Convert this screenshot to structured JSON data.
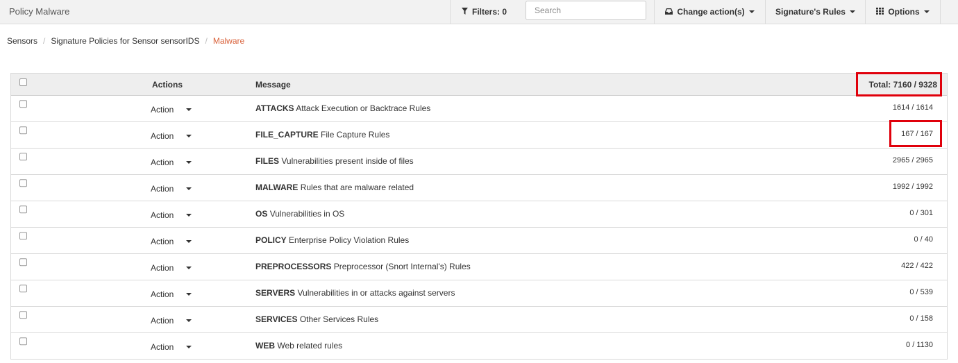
{
  "app": {
    "title": "Policy Malware"
  },
  "toolbar": {
    "filters_label": "Filters: 0",
    "search_placeholder": "Search",
    "search_value": "",
    "change_actions_label": "Change action(s)",
    "signature_rules_label": "Signature's Rules",
    "options_label": "Options"
  },
  "breadcrumb": {
    "items": [
      "Sensors",
      "Signature Policies for Sensor sensorIDS",
      "Malware"
    ]
  },
  "table": {
    "headers": {
      "actions": "Actions",
      "message": "Message",
      "total": "Total: 7160 / 9328"
    },
    "rows": [
      {
        "action": "Action",
        "name": "ATTACKS",
        "desc": "Attack Execution or Backtrace Rules",
        "count": "1614 / 1614"
      },
      {
        "action": "Action",
        "name": "FILE_CAPTURE",
        "desc": "File Capture Rules",
        "count": "167 / 167"
      },
      {
        "action": "Action",
        "name": "FILES",
        "desc": "Vulnerabilities present inside of files",
        "count": "2965 / 2965"
      },
      {
        "action": "Action",
        "name": "MALWARE",
        "desc": "Rules that are malware related",
        "count": "1992 / 1992"
      },
      {
        "action": "Action",
        "name": "OS",
        "desc": "Vulnerabilities in OS",
        "count": "0 / 301"
      },
      {
        "action": "Action",
        "name": "POLICY",
        "desc": "Enterprise Policy Violation Rules",
        "count": "0 / 40"
      },
      {
        "action": "Action",
        "name": "PREPROCESSORS",
        "desc": "Preprocessor (Snort Internal's) Rules",
        "count": "422 / 422"
      },
      {
        "action": "Action",
        "name": "SERVERS",
        "desc": "Vulnerabilities in or attacks against servers",
        "count": "0 / 539"
      },
      {
        "action": "Action",
        "name": "SERVICES",
        "desc": "Other Services Rules",
        "count": "0 / 158"
      },
      {
        "action": "Action",
        "name": "WEB",
        "desc": "Web related rules",
        "count": "0 / 1130"
      }
    ]
  },
  "colors": {
    "accent": "#d9613a",
    "highlight": "#e0000b",
    "header_bg": "#eeeeee"
  },
  "icons": {
    "filter": "filter-icon",
    "change_actions": "inbox-icon",
    "options": "grid-icon",
    "dropdown": "caret-down-icon"
  }
}
